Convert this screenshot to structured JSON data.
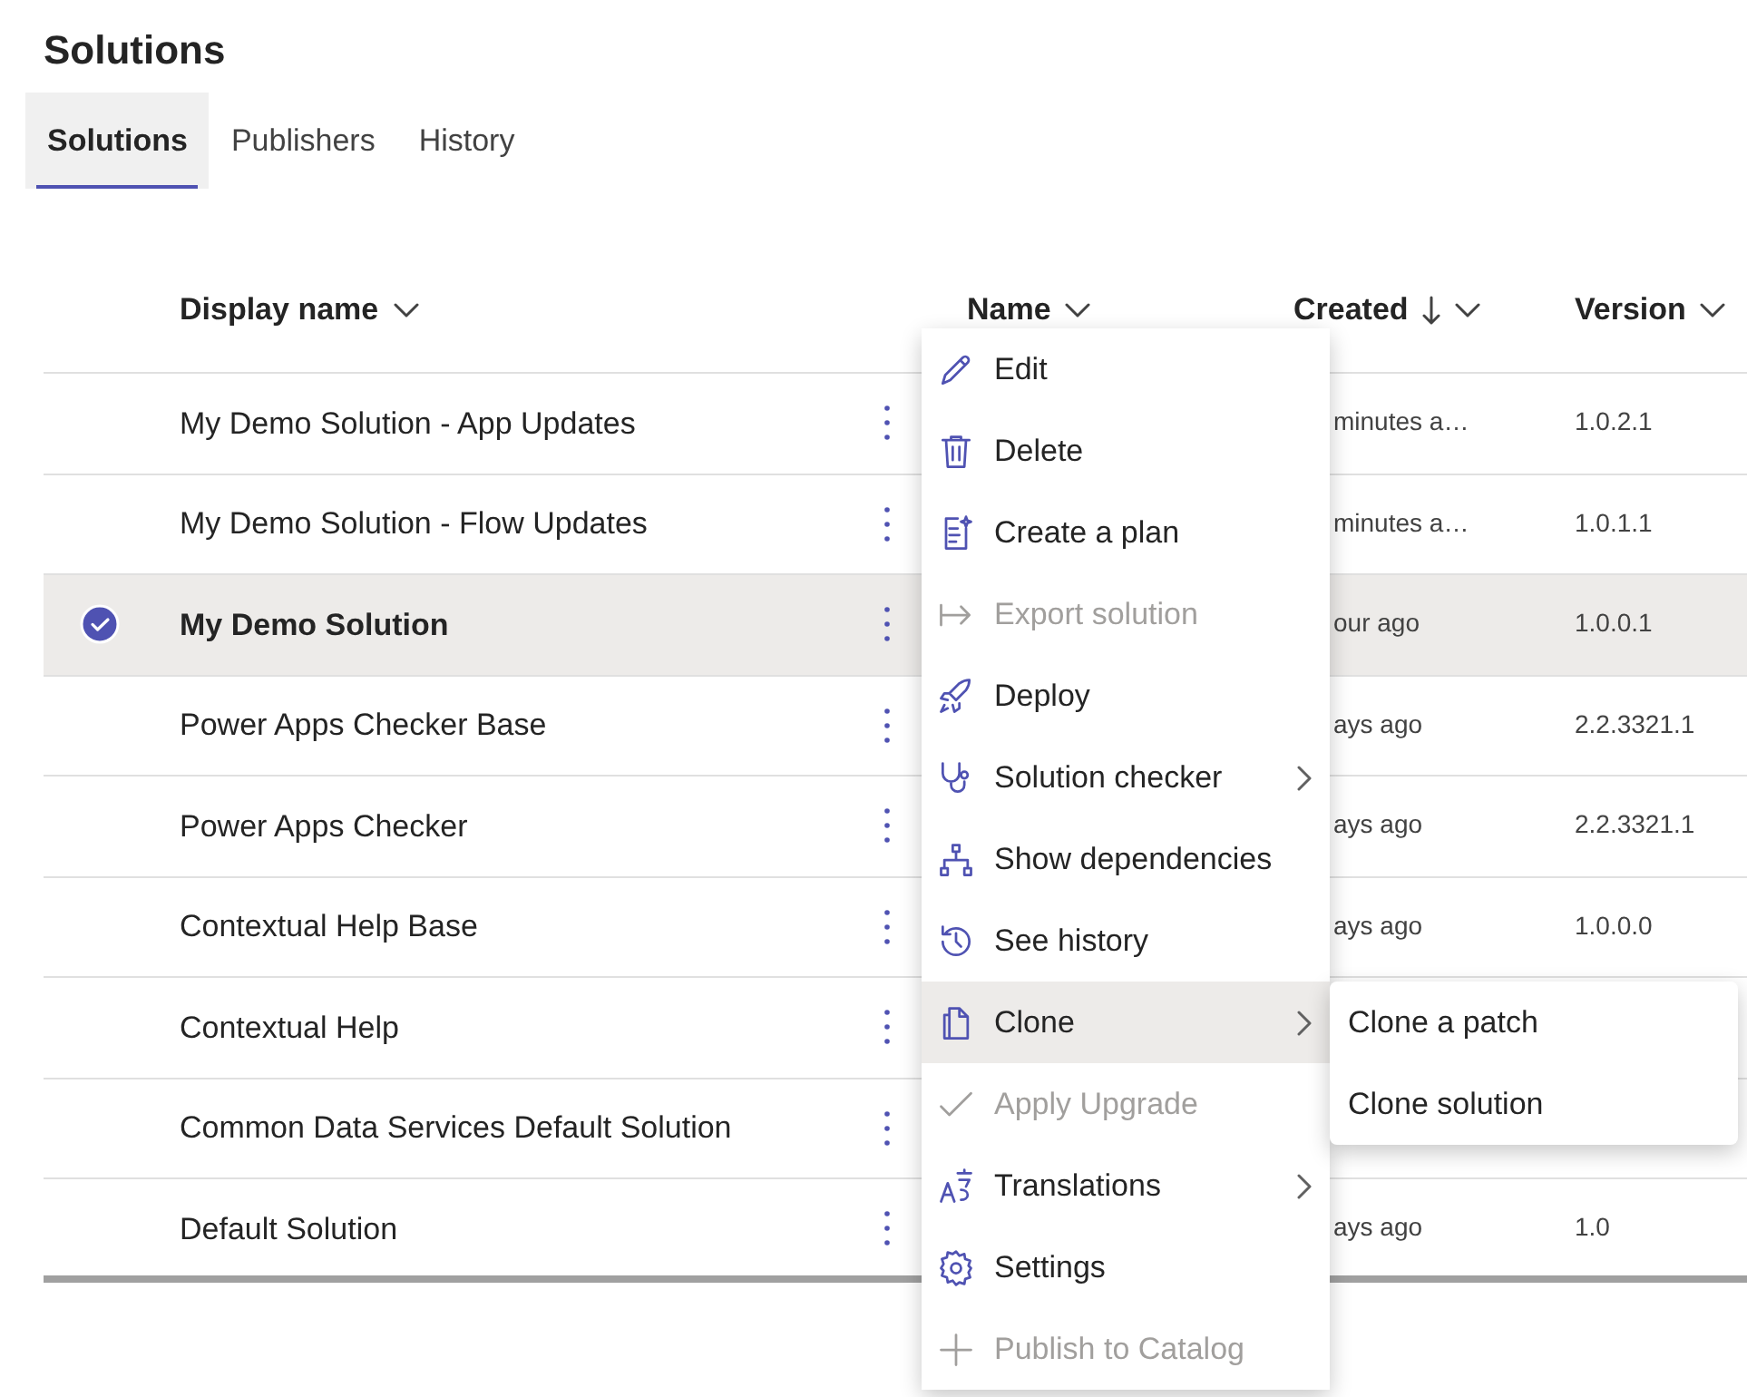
{
  "title": "Solutions",
  "tabs": [
    {
      "label": "Solutions",
      "selected": true
    },
    {
      "label": "Publishers",
      "selected": false
    },
    {
      "label": "History",
      "selected": false
    }
  ],
  "table": {
    "columns": [
      {
        "label": "Display name"
      },
      {
        "label": "Name"
      },
      {
        "label": "Created",
        "sorted_descending": true
      },
      {
        "label": "Version"
      }
    ],
    "rows": [
      {
        "display_name": "My Demo Solution - App Updates",
        "selected": false,
        "created": "minutes a…",
        "version": "1.0.2.1"
      },
      {
        "display_name": "My Demo Solution - Flow Updates",
        "selected": false,
        "created": "minutes a…",
        "version": "1.0.1.1"
      },
      {
        "display_name": "My Demo Solution",
        "selected": true,
        "created": "our ago",
        "version": "1.0.0.1"
      },
      {
        "display_name": "Power Apps Checker Base",
        "selected": false,
        "created": "ays ago",
        "version": "2.2.3321.1"
      },
      {
        "display_name": "Power Apps Checker",
        "selected": false,
        "created": "ays ago",
        "version": "2.2.3321.1"
      },
      {
        "display_name": "Contextual Help Base",
        "selected": false,
        "created": "ays ago",
        "version": "1.0.0.0"
      },
      {
        "display_name": "Contextual Help",
        "selected": false
      },
      {
        "display_name": "Common Data Services Default Solution",
        "selected": false
      },
      {
        "display_name": "Default Solution",
        "selected": false,
        "created": "ays ago",
        "version": "1.0"
      }
    ]
  },
  "context_menu": {
    "items": [
      {
        "label": "Edit",
        "disabled": false,
        "submenu": false,
        "highlighted": false
      },
      {
        "label": "Delete",
        "disabled": false,
        "submenu": false,
        "highlighted": false
      },
      {
        "label": "Create a plan",
        "disabled": false,
        "submenu": false,
        "highlighted": false
      },
      {
        "label": "Export solution",
        "disabled": true,
        "submenu": false,
        "highlighted": false
      },
      {
        "label": "Deploy",
        "disabled": false,
        "submenu": false,
        "highlighted": false
      },
      {
        "label": "Solution checker",
        "disabled": false,
        "submenu": true,
        "highlighted": false
      },
      {
        "label": "Show dependencies",
        "disabled": false,
        "submenu": false,
        "highlighted": false
      },
      {
        "label": "See history",
        "disabled": false,
        "submenu": false,
        "highlighted": false
      },
      {
        "label": "Clone",
        "disabled": false,
        "submenu": true,
        "highlighted": true
      },
      {
        "label": "Apply Upgrade",
        "disabled": true,
        "submenu": false,
        "highlighted": false
      },
      {
        "label": "Translations",
        "disabled": false,
        "submenu": true,
        "highlighted": false
      },
      {
        "label": "Settings",
        "disabled": false,
        "submenu": false,
        "highlighted": false
      },
      {
        "label": "Publish to Catalog",
        "disabled": true,
        "submenu": false,
        "highlighted": false
      }
    ]
  },
  "submenu": {
    "items": [
      {
        "label": "Clone a patch"
      },
      {
        "label": "Clone solution"
      }
    ]
  }
}
